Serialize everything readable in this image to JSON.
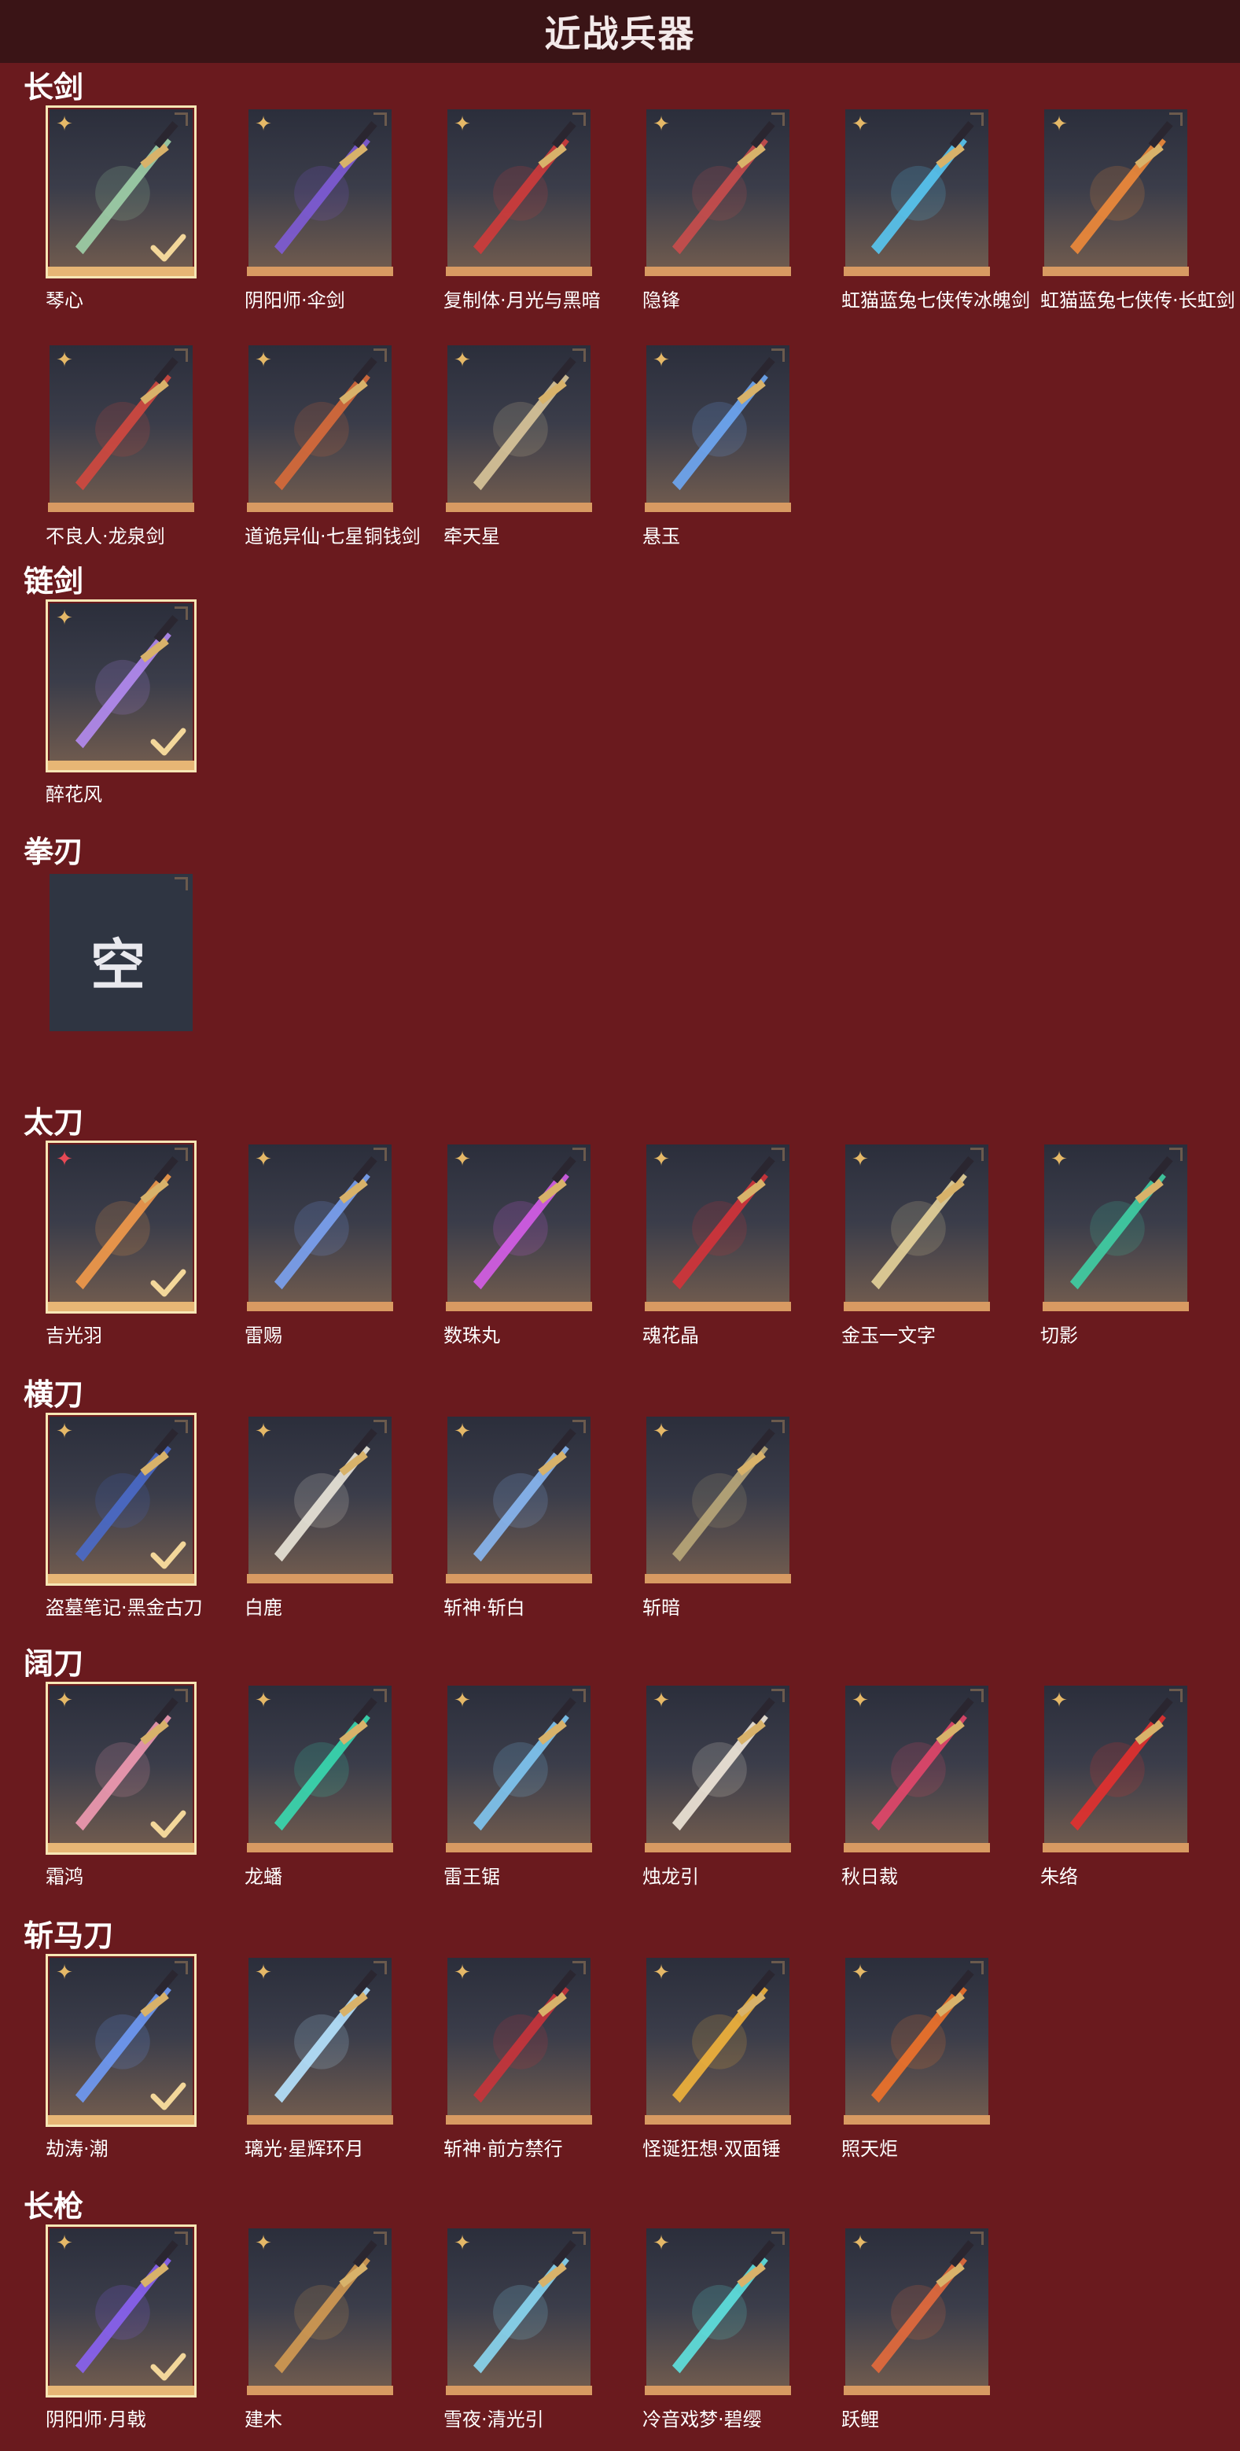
{
  "page": {
    "title": "近战兵器"
  },
  "sections": [
    {
      "id": "changjian",
      "title": "长剑",
      "items": [
        {
          "label": "琴心",
          "selected": true,
          "rank": "gold",
          "color": "#9fd0a8"
        },
        {
          "label": "阴阳师·伞剑",
          "selected": false,
          "rank": "gold",
          "color": "#7e5bd6"
        },
        {
          "label": "复制体·月光与黑暗",
          "selected": false,
          "rank": "gold",
          "color": "#cf3b3b"
        },
        {
          "label": "隐锋",
          "selected": false,
          "rank": "gold",
          "color": "#c94c4c"
        },
        {
          "label": "虹猫蓝兔七侠传冰魄剑",
          "selected": false,
          "rank": "gold",
          "color": "#58c7f2"
        },
        {
          "label": "虹猫蓝兔七侠传·长虹剑",
          "selected": false,
          "rank": "gold",
          "color": "#f08a3a"
        },
        {
          "label": "不良人·龙泉剑",
          "selected": false,
          "rank": "gold",
          "color": "#d1483f"
        },
        {
          "label": "道诡异仙·七星铜钱剑",
          "selected": false,
          "rank": "gold",
          "color": "#d86a3a"
        },
        {
          "label": "牵天星",
          "selected": false,
          "rank": "gold",
          "color": "#d9c59a"
        },
        {
          "label": "悬玉",
          "selected": false,
          "rank": "gold",
          "color": "#6ea7f4"
        }
      ]
    },
    {
      "id": "lianjian",
      "title": "链剑",
      "items": [
        {
          "label": "醉花风",
          "selected": true,
          "rank": "gold",
          "color": "#b48bf2"
        }
      ]
    },
    {
      "id": "quanren",
      "title": "拳刃",
      "items": [
        {
          "label": "",
          "selected": false,
          "empty": true,
          "empty_text": "空"
        }
      ]
    },
    {
      "id": "taidao",
      "title": "太刀",
      "items": [
        {
          "label": "吉光羽",
          "selected": true,
          "rank": "red",
          "color": "#f39a4a"
        },
        {
          "label": "雷赐",
          "selected": false,
          "rank": "gold",
          "color": "#7ba2f2"
        },
        {
          "label": "数珠丸",
          "selected": false,
          "rank": "gold",
          "color": "#d55de8"
        },
        {
          "label": "魂花晶",
          "selected": false,
          "rank": "gold",
          "color": "#d3333a"
        },
        {
          "label": "金玉一文字",
          "selected": false,
          "rank": "gold",
          "color": "#e6d39a"
        },
        {
          "label": "切影",
          "selected": false,
          "rank": "gold",
          "color": "#3fcfa4"
        }
      ]
    },
    {
      "id": "hengdao",
      "title": "横刀",
      "items": [
        {
          "label": "盗墓笔记·黑金古刀",
          "selected": true,
          "rank": "gold",
          "color": "#4a6ac9"
        },
        {
          "label": "白鹿",
          "selected": false,
          "rank": "gold",
          "color": "#eae6d9"
        },
        {
          "label": "斩神·斩白",
          "selected": false,
          "rank": "gold",
          "color": "#88b7f2"
        },
        {
          "label": "斩暗",
          "selected": false,
          "rank": "gold",
          "color": "#b9a779"
        }
      ]
    },
    {
      "id": "kuodao",
      "title": "阔刀",
      "items": [
        {
          "label": "霜鸿",
          "selected": true,
          "rank": "gold",
          "color": "#f19ab3"
        },
        {
          "label": "龙蟠",
          "selected": false,
          "rank": "gold",
          "color": "#39d9b0"
        },
        {
          "label": "雷王锯",
          "selected": false,
          "rank": "gold",
          "color": "#7fc6f2"
        },
        {
          "label": "烛龙引",
          "selected": false,
          "rank": "gold",
          "color": "#efe7d9"
        },
        {
          "label": "秋日裁",
          "selected": false,
          "rank": "gold",
          "color": "#e2466a"
        },
        {
          "label": "朱络",
          "selected": false,
          "rank": "gold",
          "color": "#e3302f"
        }
      ]
    },
    {
      "id": "zhanmadao",
      "title": "斩马刀",
      "items": [
        {
          "label": "劫涛·潮",
          "selected": true,
          "rank": "gold",
          "color": "#6f9af5"
        },
        {
          "label": "璃光·星辉环月",
          "selected": false,
          "rank": "gold",
          "color": "#b6e3ff"
        },
        {
          "label": "斩神·前方禁行",
          "selected": false,
          "rank": "gold",
          "color": "#c8343b"
        },
        {
          "label": "怪诞狂想·双面锤",
          "selected": false,
          "rank": "gold",
          "color": "#f1b23b"
        },
        {
          "label": "照天炬",
          "selected": false,
          "rank": "gold",
          "color": "#f0722a"
        }
      ]
    },
    {
      "id": "changqiang",
      "title": "长枪",
      "items": [
        {
          "label": "阴阳师·月戟",
          "selected": true,
          "rank": "gold",
          "color": "#8a62f2"
        },
        {
          "label": "建木",
          "selected": false,
          "rank": "gold",
          "color": "#d39a52"
        },
        {
          "label": "雪夜·清光引",
          "selected": false,
          "rank": "gold",
          "color": "#89d7f2"
        },
        {
          "label": "冷音戏梦·碧缨",
          "selected": false,
          "rank": "gold",
          "color": "#5ee2e0"
        },
        {
          "label": "跃鲤",
          "selected": false,
          "rank": "gold",
          "color": "#e46a3c"
        }
      ]
    }
  ]
}
